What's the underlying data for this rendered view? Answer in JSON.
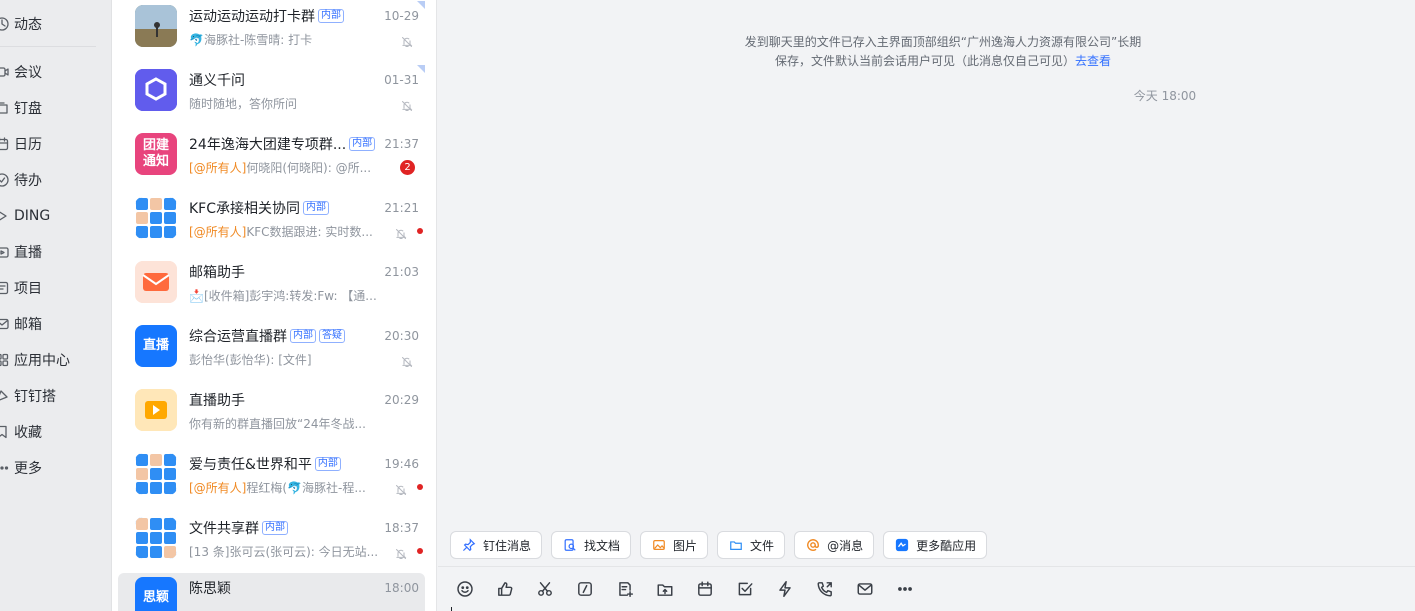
{
  "nav": {
    "items": [
      {
        "label": "动态",
        "icon": "activity-icon"
      },
      {
        "label": "会议",
        "icon": "meeting-icon"
      },
      {
        "label": "钉盘",
        "icon": "drive-icon"
      },
      {
        "label": "日历",
        "icon": "calendar-icon"
      },
      {
        "label": "待办",
        "icon": "todo-icon"
      },
      {
        "label": "DING",
        "icon": "ding-icon"
      },
      {
        "label": "直播",
        "icon": "live-icon"
      },
      {
        "label": "项目",
        "icon": "project-icon"
      },
      {
        "label": "邮箱",
        "icon": "mail-icon"
      },
      {
        "label": "应用中心",
        "icon": "apps-icon"
      },
      {
        "label": "钉钉搭",
        "icon": "builder-icon"
      },
      {
        "label": "收藏",
        "icon": "favorite-icon"
      },
      {
        "label": "更多",
        "icon": "more-icon"
      }
    ]
  },
  "conversations": [
    {
      "name": "运动运动运动打卡群",
      "tags": [
        "内部"
      ],
      "time": "10-29",
      "preview_prefix": "",
      "preview": "🐬海豚社-陈雪晴: 打卡",
      "muted": true,
      "avatar_text": "",
      "avatar_color": "#7a8b6a"
    },
    {
      "name": "通义千问",
      "tags": [],
      "time": "01-31",
      "preview_prefix": "",
      "preview": "随时随地，答你所问",
      "muted": true,
      "avatar_text": "",
      "avatar_color": "#615ced"
    },
    {
      "name": "24年逸海大团建专项群...",
      "tags": [
        "内部"
      ],
      "time": "21:37",
      "preview_prefix": "[@所有人]",
      "preview": "何晓阳(何晓阳): @所...",
      "muted": false,
      "badge": "2",
      "avatar_text": "团建\n通知",
      "avatar_color": "#e8447d"
    },
    {
      "name": "KFC承接相关协同",
      "tags": [
        "内部"
      ],
      "time": "21:21",
      "preview_prefix": "[@所有人]",
      "preview": "KFC数据跟进: 实时数...",
      "muted": true,
      "dot": true,
      "avatar_text": "",
      "avatar_color": "#2f8ef4"
    },
    {
      "name": "邮箱助手",
      "tags": [],
      "time": "21:03",
      "preview_prefix": "",
      "preview": "📩[收件箱]彭宇鸿:转发:Fw: 【通...",
      "muted": false,
      "avatar_text": "",
      "avatar_color": "#fde3d8"
    },
    {
      "name": "综合运营直播群",
      "tags": [
        "内部",
        "答疑"
      ],
      "time": "20:30",
      "preview_prefix": "",
      "preview": "彭怡华(彭怡华): [文件]",
      "muted": true,
      "avatar_text": "直播",
      "avatar_color": "#1677ff"
    },
    {
      "name": "直播助手",
      "tags": [],
      "time": "20:29",
      "preview_prefix": "",
      "preview": "你有新的群直播回放“24年冬战...",
      "muted": false,
      "avatar_text": "",
      "avatar_color": "#ffe7b8"
    },
    {
      "name": "爱与责任&世界和平",
      "tags": [
        "内部"
      ],
      "time": "19:46",
      "preview_prefix": "[@所有人]",
      "preview": "程红梅(🐬海豚社-程...",
      "muted": true,
      "dot": true,
      "avatar_text": "",
      "avatar_color": "#2f8ef4"
    },
    {
      "name": "文件共享群",
      "tags": [
        "内部"
      ],
      "time": "18:37",
      "preview_prefix": "",
      "preview": "[13 条]张可云(张可云): 今日无站...",
      "muted": true,
      "dot": true,
      "avatar_text": "",
      "avatar_color": "#2f8ef4"
    },
    {
      "name": "陈思颖",
      "tags": [],
      "time": "18:00",
      "preview_prefix": "",
      "preview": "",
      "muted": false,
      "avatar_text": "思颖",
      "avatar_color": "#1677ff",
      "active": true
    }
  ],
  "chat": {
    "system_message": "发到聊天里的文件已存入主界面顶部组织“广州逸海人力资源有限公司”长期保存，文件默认当前会话用户可见（此消息仅自己可见）",
    "system_link": "去查看",
    "timestamp": "今天 18:00",
    "quick_actions": [
      {
        "label": "钉住消息",
        "icon": "pin-icon"
      },
      {
        "label": "找文档",
        "icon": "find-doc-icon"
      },
      {
        "label": "图片",
        "icon": "image-icon"
      },
      {
        "label": "文件",
        "icon": "folder-icon"
      },
      {
        "label": "@消息",
        "icon": "at-icon"
      },
      {
        "label": "更多酷应用",
        "icon": "cool-apps-icon"
      }
    ],
    "toolbar_icons": [
      "emoji-icon",
      "thumbs-up-icon",
      "scissors-icon",
      "slash-command-icon",
      "doc-add-icon",
      "upload-icon",
      "calendar-icon",
      "task-check-icon",
      "lightning-icon",
      "phone-icon",
      "mail-icon",
      "more-icon"
    ]
  },
  "colors": {
    "accent": "#3370ff",
    "mention": "#f08a24",
    "unread": "#e02424"
  }
}
